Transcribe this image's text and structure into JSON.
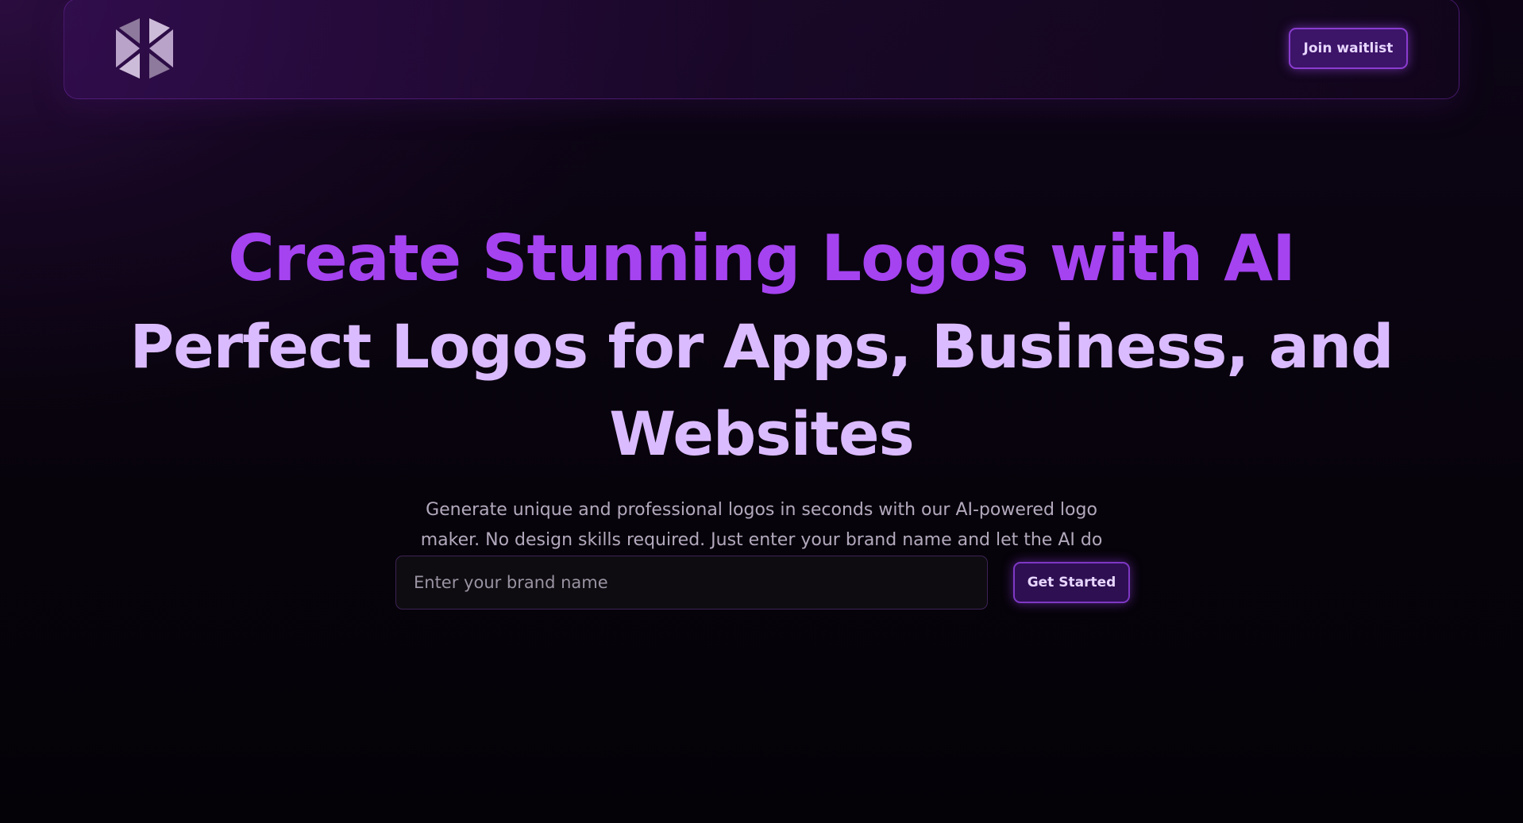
{
  "header": {
    "join_waitlist_label": "Join waitlist"
  },
  "hero": {
    "headline_primary": "Create Stunning Logos with AI",
    "headline_secondary": "Perfect Logos for Apps, Business, and Websites",
    "subtitle": "Generate unique and professional logos in seconds with our AI-powered logo maker. No design skills required. Just enter your brand name and let the AI do the rest."
  },
  "cta": {
    "brand_input_placeholder": "Enter your brand name",
    "brand_input_value": "",
    "get_started_label": "Get Started"
  },
  "colors": {
    "accent": "#a543f0",
    "headline_secondary": "#dbbbff",
    "button_bg": "#3c1468",
    "button_border": "#8a3ccf",
    "background": "#040207"
  },
  "icons": {
    "brand_logo": "hexagon-diamond-logo-icon"
  }
}
